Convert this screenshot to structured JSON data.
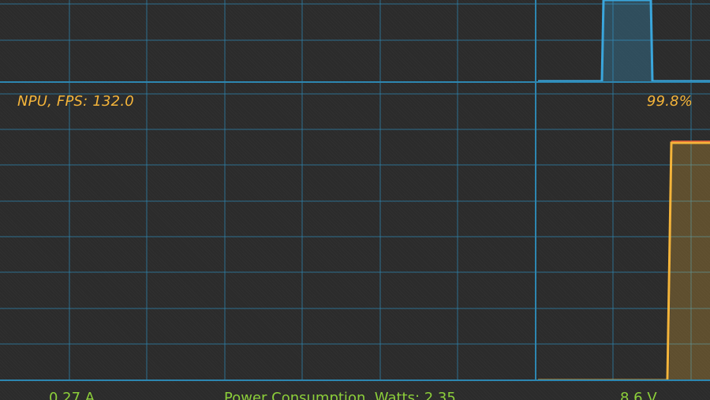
{
  "npu_panel": {
    "title": "NPU, FPS:  132.0",
    "load": "99.8%",
    "line_color": "#f4b43a"
  },
  "top_panel": {
    "line_color": "#3aa6dc"
  },
  "grid_color": "#2d86b0",
  "footer": {
    "current": "0.27 A",
    "power": "Power Consumption, Watts:    2.35",
    "voltage": "8.6 V",
    "text_color": "#8ccf3a"
  }
}
